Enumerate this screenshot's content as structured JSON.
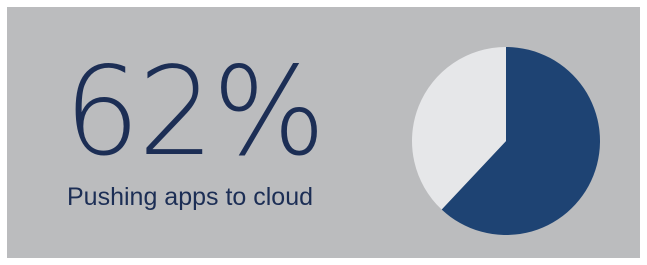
{
  "stat": {
    "value": "62%",
    "label": "Pushing apps to cloud"
  },
  "colors": {
    "background": "#bbbcbe",
    "accent": "#1e4373",
    "remainder": "#e6e7e9",
    "text": "#1c2e55"
  },
  "chart_data": {
    "type": "pie",
    "categories": [
      "",
      ""
    ],
    "values": [
      62,
      38
    ]
  }
}
